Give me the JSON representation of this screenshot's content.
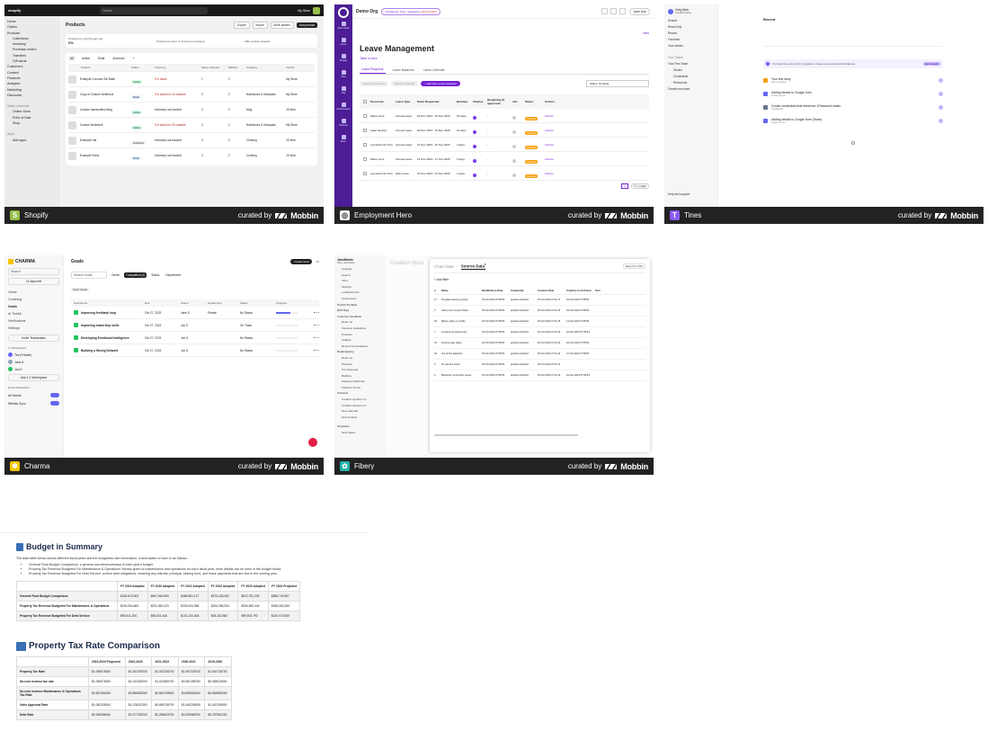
{
  "cards": {
    "shopify": {
      "app": "Shopify",
      "accent": "#95bf47",
      "sidebar": [
        "Home",
        "Orders",
        "Products",
        "Collections",
        "Inventory",
        "Purchase orders",
        "Transfers",
        "Gift cards",
        "Customers",
        "Content",
        "Finances",
        "Analytics",
        "Marketing",
        "Discounts",
        "Sales channels",
        "Online Store",
        "Point of Sale",
        "Shop",
        "Apps",
        "Add apps",
        "Settings"
      ],
      "search": "Search",
      "shop_name": "My Store",
      "title": "Products",
      "actions": [
        "Export",
        "Import",
        "More actions",
        "Add product"
      ],
      "stats": [
        "Products by sell-through rate",
        "Products by days of inventory remaining",
        "ABC product analysis"
      ],
      "stat_value": "0%",
      "tabs": [
        "All",
        "Active",
        "Draft",
        "Archived",
        "+"
      ],
      "columns": [
        "Product",
        "Status",
        "Inventory",
        "Sales channels",
        "Markets",
        "Category",
        "Vendor"
      ],
      "rows": [
        [
          "Example Coconut Gel Base",
          "Active",
          "0 in stock",
          "1",
          "2",
          "",
          "My Store"
        ],
        [
          "Copy of Custom Notebook",
          "Draft",
          "0 in stock for 24 variants",
          "2",
          "2",
          "Notebooks & Notepads",
          "My Store"
        ],
        [
          "Custom handcrafted Mug",
          "Active",
          "Inventory not tracked",
          "3",
          "2",
          "Mug",
          "JS Mob"
        ],
        [
          "Custom Notebook",
          "Active",
          "0 in stock for 24 variants",
          "3",
          "2",
          "Notebooks & Notepads",
          "My Store"
        ],
        [
          "Example Hat",
          "Archived",
          "Inventory not tracked",
          "3",
          "2",
          "Clothing",
          "JS Mob"
        ],
        [
          "Example Pants",
          "Draft",
          "Inventory not tracked",
          "3",
          "2",
          "Clothing",
          "JS Mob"
        ]
      ]
    },
    "eh": {
      "app": "Employment Hero",
      "accent": "#7622d7",
      "org": "Demo Org",
      "trial": "14 Platinum Trial - Subscribe",
      "trial_badge": "2 DAYS LEFT",
      "user": "Jane Doe",
      "nav": [
        "Start Guide",
        "Home",
        "People",
        "Files",
        "Pay",
        "Performance",
        "Settings",
        "More"
      ],
      "title": "Leave Management",
      "tour": "Take a tour",
      "new": "New",
      "tabs": [
        "Leave Requests",
        "Leave Balances",
        "Leave Calendar"
      ],
      "buttons": [
        "Approve Selected",
        "Decline Selected",
        "+ Add New Leave Request"
      ],
      "filter": "Status: Pending",
      "columns": [
        "Personnel",
        "Leave Type",
        "Dates Requested",
        "Duration",
        "Clashes",
        "Remaining (If approved)",
        "Info",
        "Status",
        "Actions"
      ],
      "rows": [
        [
          "Marie Curie",
          "Annual Leave",
          "04 Dec 2023 - 22 Dec 2023",
          "15 days",
          "-",
          "Pending",
          "Actions"
        ],
        [
          "Isaac Newton",
          "Annual Leave",
          "04 Dec 2023 - 15 Dec 2023",
          "10 days",
          "-",
          "Pending",
          "Actions"
        ],
        [
          "Leonardo Da Vinci",
          "Annual Leave",
          "27 Nov 2023 - 30 Nov 2023",
          "4 days",
          "-",
          "Pending",
          "Actions"
        ],
        [
          "Marie Curie",
          "Annual Leave",
          "13 Nov 2023 - 17 Nov 2023",
          "5 days",
          "-",
          "Pending",
          "Actions"
        ],
        [
          "Leonardo Da Vinci",
          "Sick Leave",
          "01 Nov 2023 - 01 Nov 2023",
          "1 days",
          "-",
          "Pending",
          "Actions"
        ]
      ],
      "pager": "1",
      "per_page": "10 / page"
    },
    "tines": {
      "app": "Tines",
      "accent": "#8b5cf6",
      "user": "Greg Mob",
      "user_sub": "Greatmob team",
      "nav": [
        "Search",
        "Read-Only",
        "Recent",
        "Favorites",
        "Your stories",
        "Your Teams",
        "Your First Team",
        "Stories",
        "Credentials",
        "Resources",
        "Create new team",
        "Help and support"
      ],
      "heading": "Recent",
      "banner": "Your plan has a story limit. Upgrade to create more and unlock all features.",
      "banner_button": "Get in touch",
      "items": [
        [
          "Your first story",
          "Ask a question"
        ],
        [
          "Adding details to Google form",
          "Create a form"
        ],
        [
          "Create credentials that reference 1Password vaults",
          "Credentials"
        ],
        [
          "Adding details to Google form (Team)",
          "Create a form"
        ]
      ]
    },
    "charma": {
      "app": "Charma",
      "accent": "#f5c400",
      "brand": "CHARMA",
      "search": "Search",
      "trial": "11 days left",
      "nav": [
        "Home",
        "Coaching",
        "Goals",
        "AI Toolkit",
        "Verifications",
        "Settings"
      ],
      "invite": "Invite Teammates",
      "section_people": "1:1 Workspaces",
      "people": [
        "Tes (Private)",
        "Jane A",
        "Jon D"
      ],
      "add_ws": "Add 1:1 Workspace",
      "section_group": "Group Workspaces",
      "groups": [
        "All Hands",
        "Weekly Sync"
      ],
      "title": "Goals",
      "create": "Create Goal",
      "search_goals": "Search Goals",
      "filters": [
        "Owner",
        "Completion (1)",
        "Status",
        "Department"
      ],
      "chip": "Open Goals",
      "columns": [
        "Goal Name",
        "Due",
        "Owner",
        "Department",
        "Status",
        "Progress"
      ],
      "rows": [
        [
          "Improving feedback loop",
          "Oct 27, 2023",
          "Jane S",
          "Private",
          "No Status"
        ],
        [
          "Improving leadership skills",
          "Oct 27, 2023",
          "Jon D",
          "",
          "On Track"
        ],
        [
          "Developing Emotional Intelligence",
          "Oct 27, 2023",
          "Jon D",
          "",
          "No Status"
        ],
        [
          "Building a Strong Network",
          "Oct 27, 2023",
          "Jon D",
          "",
          "No Status"
        ]
      ]
    },
    "fibery": {
      "app": "Fibery",
      "accent": "#20b2aa",
      "workspace": "JaneMobin",
      "ws_sub": "fibery workspace",
      "nav": [
        "Upgrade",
        "Search",
        "Inbox",
        "Settings",
        "Lucidchart Info",
        "Connections",
        "Product Portfolio",
        "EFS Migs",
        "Customer Feedback",
        "Read me",
        "Interview Guidelines",
        "Products",
        "Insights",
        "Recent Conversations",
        "Roadmapping",
        "Read me",
        "Products",
        "Top Requests",
        "Backlog",
        "Features Roadmap",
        "Features funnel",
        "Frontend",
        "Creation dynamic of ...",
        "Creation dynamic of ...",
        "New calendar",
        "New timeline",
        "Templates",
        "New Space"
      ],
      "panel_title": "Creation dyna",
      "tabs": [
        "Chart Data",
        "Source Data"
      ],
      "tab_count": "6",
      "export": "Export to CSV",
      "add": "+ Add filter",
      "columns": [
        "#",
        "Name",
        "Modification Date",
        "Created By",
        "Creation Date",
        "Creation to Archived",
        "Text"
      ],
      "rows": [
        [
          "17",
          "Template starting process",
          "25-Oct-2023 07:58:53",
          "janethenmobbin2",
          "25-Oct-2023 07:41:27",
          "25-Oct-2023 07:58:53"
        ],
        [
          "3",
          "Users can't connect Slack",
          "25-Oct-2023 07:58:53",
          "janethenmobbin2",
          "25-Oct-2023 07:41:26",
          "25-Oct-2023 07:58:53"
        ],
        [
          "18",
          "Battery drain on mobile",
          "25-Oct-2023 07:58:53",
          "janethenmobbin2",
          "25-Oct-2023 07:41:25",
          "14-Oct-2023 07:58:53"
        ],
        [
          "7",
          "A channel to project lists",
          "25-Oct-2023 07:58:53",
          "janethenmobbin2",
          "25-Oct-2023 07:41:24",
          "16-Nov-2023 07:58:53"
        ],
        [
          "15",
          "Improve date picker",
          "25-Oct-2023 07:58:53",
          "janethenmobbin2",
          "25-Oct-2023 07:41:23",
          "26-Oct-2023 07:58:53"
        ],
        [
          "20",
          "Out of free tasks/tics",
          "25-Oct-2023 07:58:53",
          "janethenmobbin2",
          "25-Oct-2023 07:41:22",
          "27-Oct-2023 07:58:53"
        ],
        [
          "6",
          "No risk has found",
          "25-Oct-2023 07:58:53",
          "janethenmobbin2",
          "25-Oct-2023 07:41:21",
          ""
        ],
        [
          "4",
          "Bluetooth connectivity issues",
          "25-Oct-2023 07:58:53",
          "janethenmobbin2",
          "25-Oct-2023 07:41:20",
          "04-Nov-2023 07:58:53"
        ]
      ]
    }
  },
  "curated_by": "curated by",
  "mobbin": "Mobbin",
  "budget": {
    "title": "Budget in Summary",
    "intro": "The data table below shows different fiscal years and the budget/tax rate information. A description of each is as follows:",
    "bullets": [
      "General Fund Budget Comparison: a general overview/summary of each year's budget",
      "Property Tax Revenue Budgeted For Maintenance & Operations: Money spent of maintenance and operations for each fiscal year; more details can be seen in the budget books",
      "Property Tax Revenue Budgeted For Debt Service: current debt obligations, meaning any interest, principal, sinking fund, and lease payments that are due in the coming year."
    ],
    "columns": [
      "",
      "FY 2019 Adopted",
      "FY 2020 Adopted",
      "FY 2021 Adopted",
      "FY 2022 Adopted",
      "FY 2023 Adopted",
      "FY 2024 Projected"
    ],
    "rows": [
      [
        "General Fund Budget Comparison",
        "$426,513,903",
        "$467,946,653",
        "$468,881,127",
        "$476,228,062",
        "$512,781,232",
        "$556,726,957"
      ],
      [
        "Property Tax Revenue Budgeted For Maintenance & Operations",
        "$190,054,863",
        "$231,362,023",
        "$226,094,058",
        "$226,365,254",
        "$250,560,440",
        "$265,063,185"
      ],
      [
        "Property Tax Revenue Budgeted For Debt Service",
        "$96,911,326",
        "$98,521,446",
        "$101,230,618",
        "$93,152,582",
        "$99,502,792",
        "$120,070,000"
      ]
    ]
  },
  "tax": {
    "title": "Property Tax Rate Comparison",
    "columns": [
      "",
      "2023-2024 Proposed",
      "2022-2023",
      "2021-2022",
      "2020-2021",
      "2019-2020"
    ],
    "rows": [
      [
        "Property Tax Rate",
        "$1.098075000",
        "$1.062236700",
        "$1.067328700",
        "$1.067328700",
        "$1.061728700"
      ],
      [
        "No new revenue tax rate",
        "$1.098075000",
        "$1.022336700",
        "$1.023489700",
        "$0.967285700",
        "$0.955015900"
      ],
      [
        "No new revenue Maintenance & Operations Tax Rate",
        "$0.557054000",
        "$0.556552000",
        "$0.662708500",
        "$0.659552400",
        "$0.662850000"
      ],
      [
        "Voter Approval Rate",
        "$1.062205000",
        "$1.078037300",
        "$0.899738700",
        "$1.062205000",
        "$1.067339500"
      ],
      [
        "Debt Rate",
        "$0.298086000",
        "$0.277339700",
        "$0.285003700",
        "$0.293958700",
        "$0.297962200"
      ]
    ]
  }
}
